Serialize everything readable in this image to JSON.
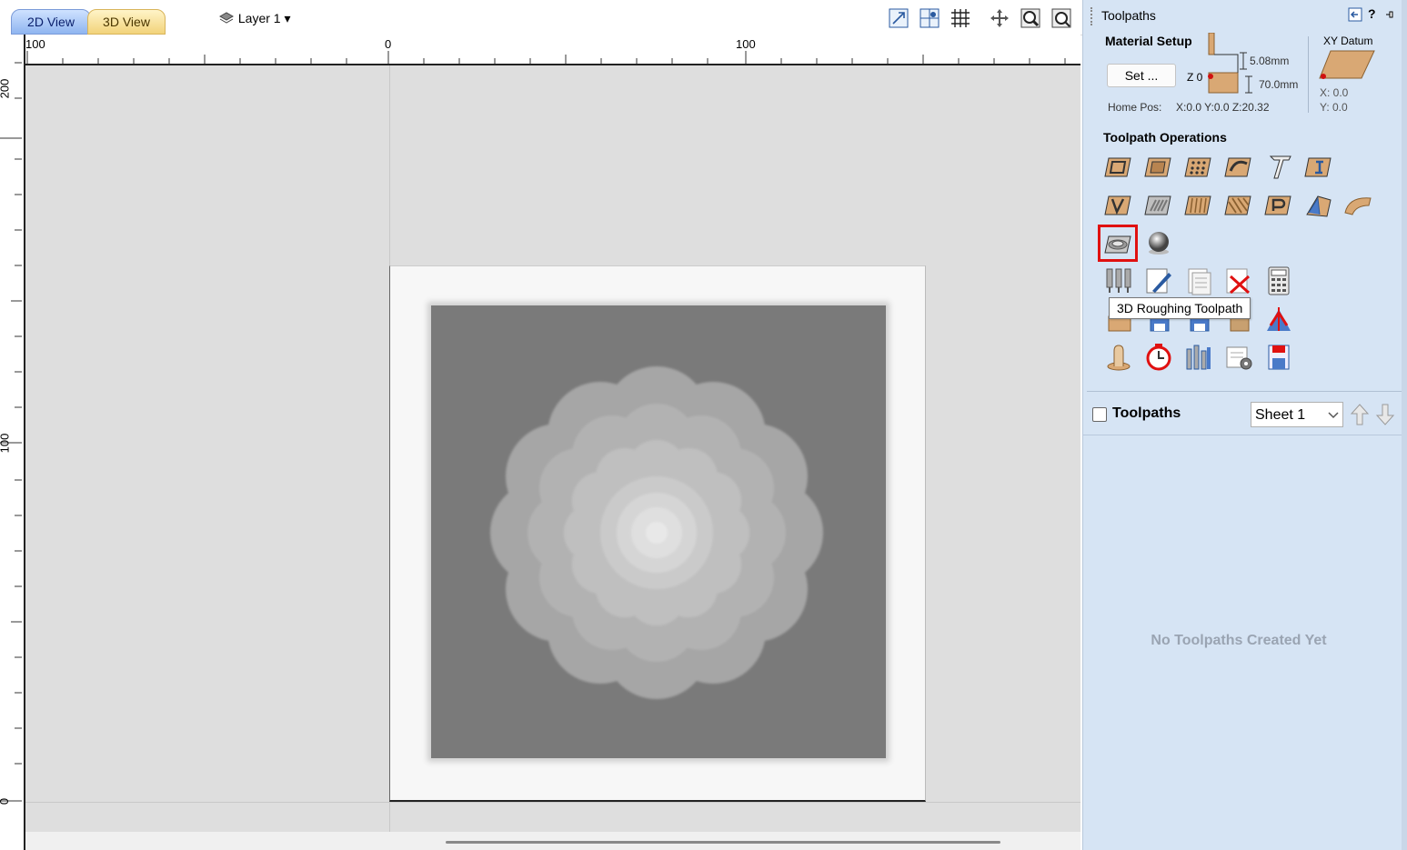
{
  "tabs": {
    "view2d": "2D View",
    "view3d": "3D View"
  },
  "layer": {
    "label": "Layer 1",
    "arrow": "▾"
  },
  "toolbar_icons": [
    "scale-to-fit-icon",
    "snap-grid-icon",
    "grid-icon",
    "pan-icon",
    "zoom-icon",
    "zoom-extents-icon"
  ],
  "ruler": {
    "h_labels": [
      "100",
      "0",
      "100"
    ],
    "v_labels": [
      "200",
      "100",
      "0"
    ]
  },
  "panel": {
    "title": "Toolpaths",
    "help": "?",
    "material_setup": {
      "heading": "Material Setup",
      "set_button": "Set ...",
      "z_label": "Z 0",
      "clearance": "5.08mm",
      "thickness": "70.0mm",
      "home_pos_label": "Home Pos:",
      "home_pos_value": "X:0.0 Y:0.0 Z:20.32"
    },
    "xy_datum": {
      "heading": "XY Datum",
      "x": "X: 0.0",
      "y": "Y: 0.0"
    },
    "operations_heading": "Toolpath Operations",
    "tooltip": "3D Roughing Toolpath",
    "list": {
      "label": "Toolpaths",
      "sheet_value": "Sheet 1",
      "empty_text": "No Toolpaths Created Yet"
    }
  },
  "colors": {
    "panel_bg": "#d6e4f4",
    "canvas_bg": "#dedede",
    "highlight": "#e01010",
    "wood": "#d9a874"
  }
}
